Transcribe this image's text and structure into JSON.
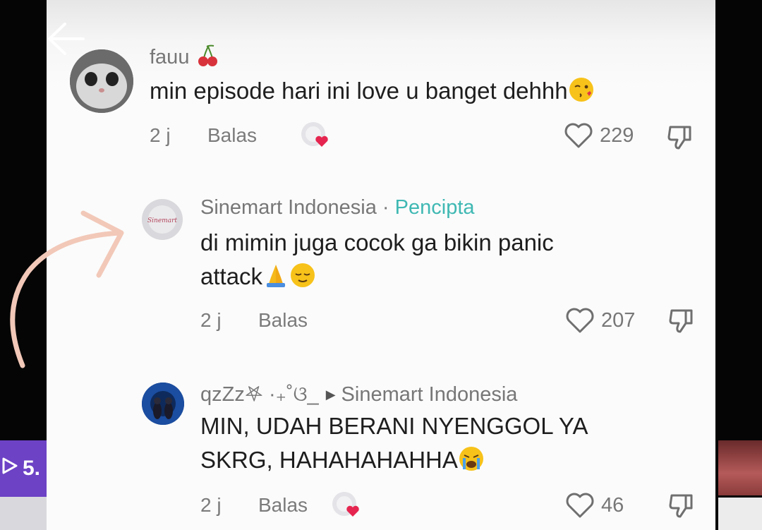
{
  "overlay": {
    "play_count": "5."
  },
  "comments": [
    {
      "username": "fauu",
      "text": "min episode hari ini love u banget dehhh",
      "time": "2 j",
      "reply_label": "Balas",
      "likes": "229"
    },
    {
      "username": "Sinemart Indonesia",
      "separator": " · ",
      "badge": "Pencipta",
      "text_line1": "di mimin juga cocok ga bikin panic",
      "text_line2": "attack",
      "time": "2 j",
      "reply_label": "Balas",
      "likes": "207"
    },
    {
      "username": "qzZz𖤐 ·₊˚ଓ_",
      "reply_to": "Sinemart Indonesia",
      "text_line1": "MIN, UDAH BERANI NYENGGOL YA",
      "text_line2": "SKRG, HAHAHAHAHHA",
      "time": "2 j",
      "reply_label": "Balas",
      "likes": "46"
    }
  ]
}
